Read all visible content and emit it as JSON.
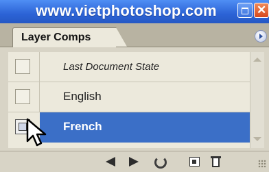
{
  "window": {
    "title": "www.vietphotoshop.com"
  },
  "panel": {
    "tab_label": "Layer Comps"
  },
  "layer_comps": [
    {
      "name": "Last Document State",
      "selected": false,
      "style": "italic"
    },
    {
      "name": "English",
      "selected": false,
      "style": "normal"
    },
    {
      "name": "French",
      "selected": true,
      "style": "normal"
    }
  ],
  "icons": {
    "minimize": "minimize-icon",
    "close": "close-icon",
    "panel_menu": "panel-menu-icon",
    "prev": "previous-comp-icon",
    "next": "next-comp-icon",
    "refresh": "update-comp-icon",
    "new": "new-comp-icon",
    "delete": "trash-icon",
    "cursor": "mouse-pointer-icon"
  },
  "colors": {
    "titlebar": "#2c63d6",
    "selected_row": "#3b6fc7",
    "panel_bg": "#d8d4c6",
    "list_bg": "#ece9dc"
  }
}
